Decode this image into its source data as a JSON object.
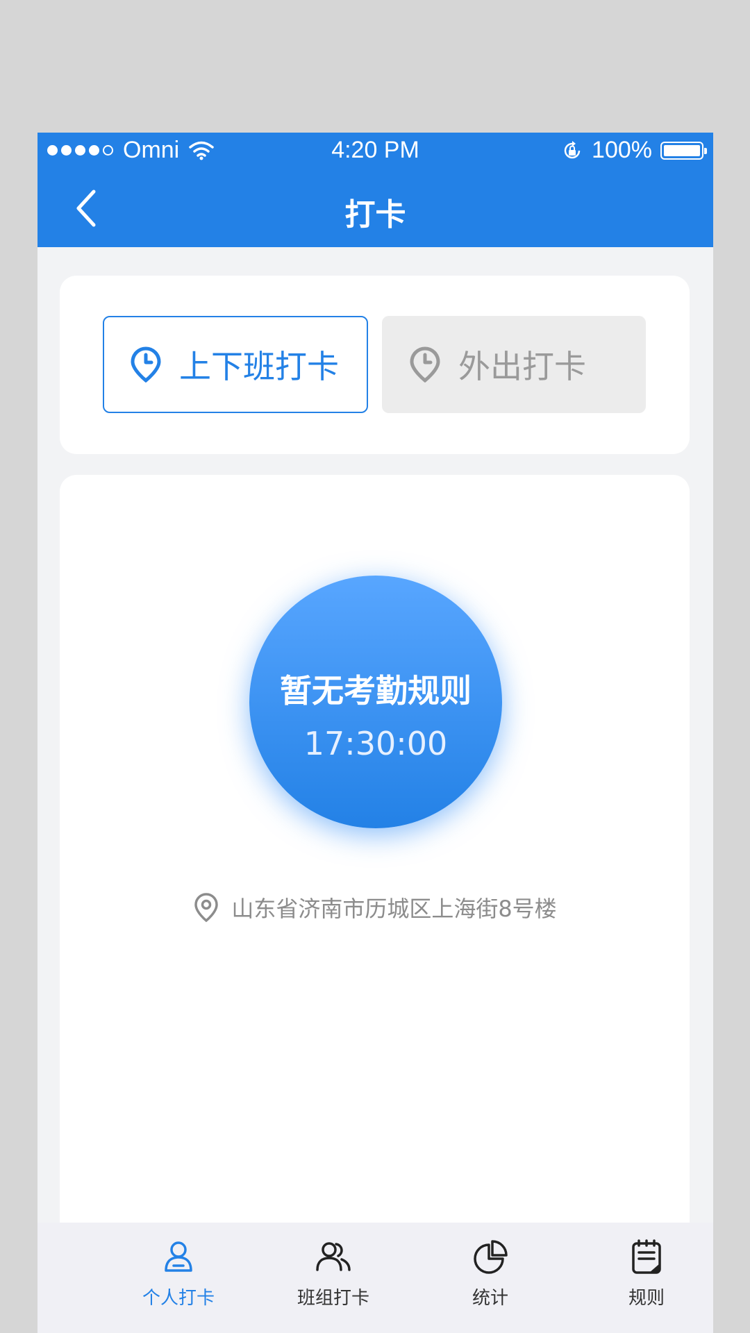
{
  "status_bar": {
    "carrier": "Omni",
    "time": "4:20 PM",
    "battery": "100%"
  },
  "nav": {
    "title": "打卡"
  },
  "punch_types": {
    "commute_label": "上下班打卡",
    "outing_label": "外出打卡",
    "active": "commute"
  },
  "clock": {
    "rule_text": "暂无考勤规则",
    "time": "17:30:00"
  },
  "location": {
    "address": "山东省济南市历城区上海街8号楼"
  },
  "tabs": [
    {
      "label": "个人打卡",
      "icon": "person-icon",
      "active": true
    },
    {
      "label": "班组打卡",
      "icon": "group-icon",
      "active": false
    },
    {
      "label": "统计",
      "icon": "pie-chart-icon",
      "active": false
    },
    {
      "label": "规则",
      "icon": "rules-icon",
      "active": false
    }
  ],
  "colors": {
    "brand": "#2381e6",
    "inactive_text": "#9a9a9a"
  }
}
